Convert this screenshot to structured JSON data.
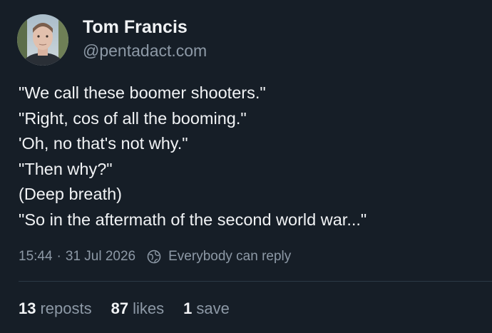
{
  "author": {
    "display_name": "Tom Francis",
    "handle": "@pentadact.com"
  },
  "post": {
    "lines": [
      "\"We call these boomer shooters.\"",
      "\"Right, cos of all the booming.\"",
      "'Oh, no that's not why.\"",
      "\"Then why?\"",
      "(Deep breath)",
      "\"So in the aftermath of the second world war...\""
    ],
    "time": "15:44",
    "separator": "·",
    "date": "31 Jul 2026",
    "reply_setting": "Everybody can reply",
    "reply_icon": "globe-icon"
  },
  "stats": {
    "reposts_count": "13",
    "reposts_label": "reposts",
    "likes_count": "87",
    "likes_label": "likes",
    "saves_count": "1",
    "saves_label": "save"
  },
  "colors": {
    "background": "#161e27",
    "primary_text": "#f1f3f5",
    "secondary_text": "#8d99a6",
    "divider": "#2c3946"
  }
}
